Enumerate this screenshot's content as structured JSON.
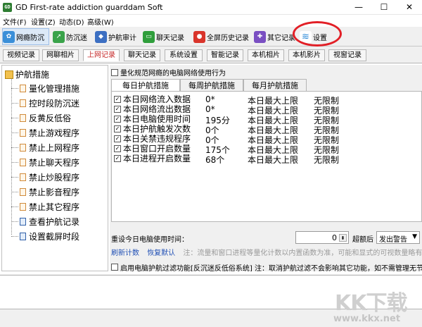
{
  "window": {
    "title": "GD First-rate addiction guarddam Soft",
    "app_icon_text": "GD",
    "minimize": "—",
    "maximize": "☐",
    "close": "✕"
  },
  "menu": [
    "文件(F)",
    "设置(Z)",
    "动态(D)",
    "高级(W)"
  ],
  "toolbar": [
    {
      "label": "网瘾防沉",
      "icon": "flower-icon",
      "color": "#3a8fd8"
    },
    {
      "label": "防沉迷",
      "icon": "arrow-icon",
      "color": "#3aa34a"
    },
    {
      "label": "护航审计",
      "icon": "shield-icon",
      "color": "#3c6fc2"
    },
    {
      "label": "聊天记录",
      "icon": "chat-icon",
      "color": "#2f9e3b"
    },
    {
      "label": "全屏历史记录",
      "icon": "camera-icon",
      "color": "#d9342b"
    },
    {
      "label": "其它记录",
      "icon": "puzzle-icon",
      "color": "#7a4fc2"
    },
    {
      "label": "设置",
      "icon": "wifi-icon",
      "color": "#2c8ad8"
    }
  ],
  "sub_tabs": [
    "视频记录",
    "网聊相片",
    "上网记录",
    "聊天记录",
    "系统设置",
    "智能记录",
    "本机相片",
    "本机影片",
    "视窗记录"
  ],
  "tree": {
    "root": "护航措施",
    "items": [
      "量化管理措施",
      "控时段防沉迷",
      "反黄反低俗",
      "禁止游戏程序",
      "禁止上网程序",
      "禁止聊天程序",
      "禁止炒股程序",
      "禁止影音程序",
      "禁止其它程序",
      "查看护航记录",
      "设置截屏时段"
    ]
  },
  "behavior_checkbox": "量化规范网瘾的电脑网络使用行为",
  "period_tabs": [
    "每日护航措施",
    "每周护航措施",
    "每月护航措施"
  ],
  "table": {
    "rows": [
      {
        "name": "本日网络流入数据",
        "value": "0*",
        "limit": "本日最大上限",
        "setting": "无限制"
      },
      {
        "name": "本日网络流出数据",
        "value": "0*",
        "limit": "本日最大上限",
        "setting": "无限制"
      },
      {
        "name": "本日电脑使用时间",
        "value": "195分",
        "limit": "本日最大上限",
        "setting": "无限制"
      },
      {
        "name": "本日护航触发次数",
        "value": "0个",
        "limit": "本日最大上限",
        "setting": "无限制"
      },
      {
        "name": "本日关禁违规程序",
        "value": "0个",
        "limit": "本日最大上限",
        "setting": "无限制"
      },
      {
        "name": "本日窗口开启数量",
        "value": "175个",
        "limit": "本日最大上限",
        "setting": "无限制"
      },
      {
        "name": "本日进程开启数量",
        "value": "68个",
        "limit": "本日最大上限",
        "setting": "无限制"
      }
    ]
  },
  "reset": {
    "label": "重设今日电脑使用时间：",
    "value": "0",
    "suffix": "超额后",
    "action": "发出警告"
  },
  "links": {
    "refresh": "刷新计数",
    "restore": "恢复默认",
    "hint": "注：流量和窗口进程等量化计数以内置函数为准，可能和显式的可视数量略有差异"
  },
  "filter_checkbox": "启用电脑护航过滤功能[反沉迷反低俗系统] 注：取消护航过滤不会影响其它功能，如不需管理无节制的电脑使用",
  "watermark": {
    "logo": "KK下载",
    "url": "www.kkx.net"
  }
}
